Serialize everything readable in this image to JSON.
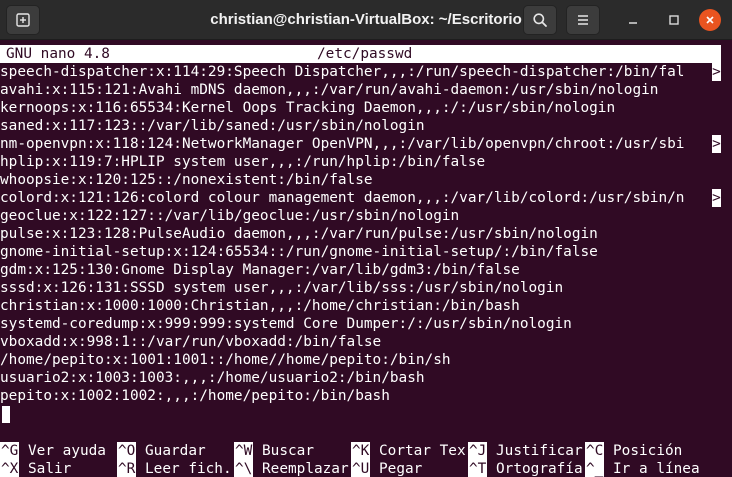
{
  "window": {
    "title": "christian@christian-VirtualBox: ~/Escritorio"
  },
  "icons": {
    "new_tab": "new-tab-icon",
    "search": "search-icon",
    "menu": "hamburger-menu-icon",
    "minimize": "minimize-icon",
    "maximize": "maximize-icon",
    "close": "close-icon"
  },
  "nano": {
    "version": "GNU nano 4.8",
    "filename": "/etc/passwd",
    "truncation_marker": ">",
    "lines": [
      "speech-dispatcher:x:114:29:Speech Dispatcher,,,:/run/speech-dispatcher:/bin/fal",
      "avahi:x:115:121:Avahi mDNS daemon,,,:/var/run/avahi-daemon:/usr/sbin/nologin",
      "kernoops:x:116:65534:Kernel Oops Tracking Daemon,,,:/:/usr/sbin/nologin",
      "saned:x:117:123::/var/lib/saned:/usr/sbin/nologin",
      "nm-openvpn:x:118:124:NetworkManager OpenVPN,,,:/var/lib/openvpn/chroot:/usr/sbi",
      "hplip:x:119:7:HPLIP system user,,,:/run/hplip:/bin/false",
      "whoopsie:x:120:125::/nonexistent:/bin/false",
      "colord:x:121:126:colord colour management daemon,,,:/var/lib/colord:/usr/sbin/n",
      "geoclue:x:122:127::/var/lib/geoclue:/usr/sbin/nologin",
      "pulse:x:123:128:PulseAudio daemon,,,:/var/run/pulse:/usr/sbin/nologin",
      "gnome-initial-setup:x:124:65534::/run/gnome-initial-setup/:/bin/false",
      "gdm:x:125:130:Gnome Display Manager:/var/lib/gdm3:/bin/false",
      "sssd:x:126:131:SSSD system user,,,:/var/lib/sss:/usr/sbin/nologin",
      "christian:x:1000:1000:Christian,,,:/home/christian:/bin/bash",
      "systemd-coredump:x:999:999:systemd Core Dumper:/:/usr/sbin/nologin",
      "vboxadd:x:998:1::/var/run/vboxadd:/bin/false",
      "/home/pepito:x:1001:1001::/home//home/pepito:/bin/sh",
      "usuario2:x:1003:1003:,,,:/home/usuario2:/bin/bash",
      "pepito:x:1002:1002:,,,:/home/pepito:/bin/bash"
    ],
    "shortcuts_row1": [
      {
        "key": "^G",
        "label": "Ver ayuda"
      },
      {
        "key": "^O",
        "label": "Guardar"
      },
      {
        "key": "^W",
        "label": "Buscar"
      },
      {
        "key": "^K",
        "label": "Cortar Tex"
      },
      {
        "key": "^J",
        "label": "Justificar"
      },
      {
        "key": "^C",
        "label": "Posición"
      }
    ],
    "shortcuts_row2": [
      {
        "key": "^X",
        "label": "Salir"
      },
      {
        "key": "^R",
        "label": "Leer fich."
      },
      {
        "key": "^\\",
        "label": "Reemplazar"
      },
      {
        "key": "^U",
        "label": "Pegar"
      },
      {
        "key": "^T",
        "label": "Ortografía"
      },
      {
        "key": "^_",
        "label": "Ir a línea"
      }
    ]
  },
  "colors": {
    "terminal_bg": "#300a24",
    "terminal_fg": "#ffffff",
    "titlebar_bg": "#2b2b2b",
    "close_button": "#e95420"
  }
}
